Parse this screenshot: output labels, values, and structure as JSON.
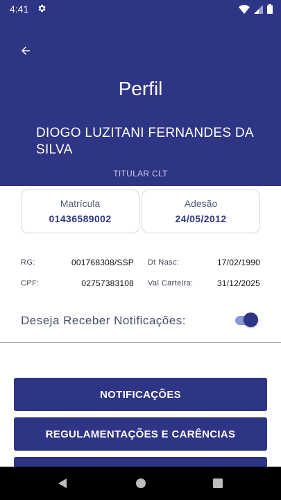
{
  "status_bar": {
    "time": "4:41"
  },
  "header": {
    "title": "Perfil",
    "name": "DIOGO LUZITANI FERNANDES DA SILVA",
    "role": "TITULAR CLT"
  },
  "cards": {
    "matricula": {
      "label": "Matrícula",
      "value": "01436589002"
    },
    "adesao": {
      "label": "Adesão",
      "value": "24/05/2012"
    }
  },
  "info": {
    "rg": {
      "label": "RG:",
      "value": "001768308/SSP"
    },
    "cpf": {
      "label": "CPF:",
      "value": "02757383108"
    },
    "dt_nasc": {
      "label": "Dt Nasc:",
      "value": "17/02/1990"
    },
    "val_carteira": {
      "label": "Val Carteira:",
      "value": "31/12/2025"
    }
  },
  "notifications": {
    "label": "Deseja Receber Notificações:",
    "enabled": true
  },
  "buttons": {
    "notificacoes": "NOTIFICAÇÕES",
    "regulamentacoes": "REGULAMENTAÇÕES E CARÊNCIAS",
    "third": ""
  },
  "colors": {
    "primary": "#2f3585",
    "toggle_track": "#8d98d8"
  },
  "icons": [
    "settings-gear-icon",
    "wifi-icon",
    "signal-icon",
    "battery-icon",
    "back-arrow-icon",
    "nav-back-icon",
    "nav-home-icon",
    "nav-recents-icon"
  ]
}
